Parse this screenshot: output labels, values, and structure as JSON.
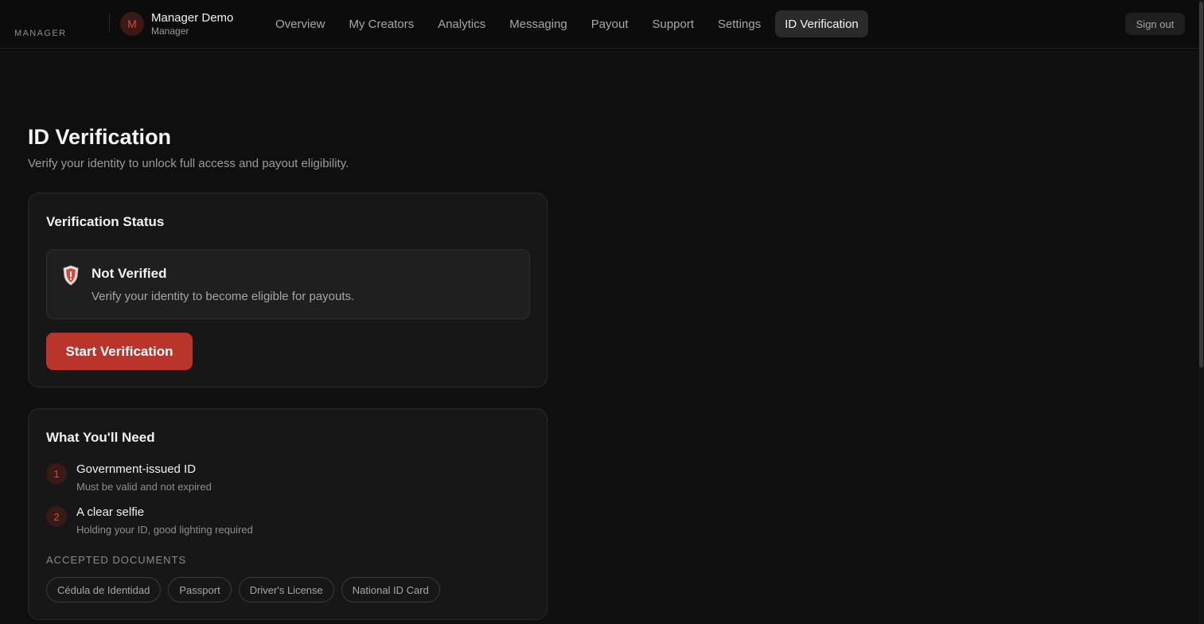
{
  "header": {
    "brand": "MANAGER",
    "avatar_initial": "M",
    "user_name": "Manager Demo",
    "user_role": "Manager",
    "nav": [
      {
        "label": "Overview",
        "active": false
      },
      {
        "label": "My Creators",
        "active": false
      },
      {
        "label": "Analytics",
        "active": false
      },
      {
        "label": "Messaging",
        "active": false
      },
      {
        "label": "Payout",
        "active": false
      },
      {
        "label": "Support",
        "active": false
      },
      {
        "label": "Settings",
        "active": false
      },
      {
        "label": "ID Verification",
        "active": true
      }
    ],
    "sign_out": "Sign out"
  },
  "page": {
    "title": "ID Verification",
    "subtitle": "Verify your identity to unlock full access and payout eligibility."
  },
  "status_card": {
    "title": "Verification Status",
    "status_icon": "shield-icon",
    "status_title": "Not Verified",
    "status_desc": "Verify your identity to become eligible for payouts.",
    "button": "Start Verification"
  },
  "needs_card": {
    "title": "What You'll Need",
    "requirements": [
      {
        "number": "1",
        "title": "Government-issued ID",
        "desc": "Must be valid and not expired"
      },
      {
        "number": "2",
        "title": "A clear selfie",
        "desc": "Holding your ID, good lighting required"
      }
    ],
    "docs_label": "ACCEPTED DOCUMENTS",
    "documents": [
      "Cédula de Identidad",
      "Passport",
      "Driver's License",
      "National ID Card"
    ]
  },
  "colors": {
    "accent": "#b9352b",
    "background": "#0f0f0f",
    "card": "#171717"
  }
}
